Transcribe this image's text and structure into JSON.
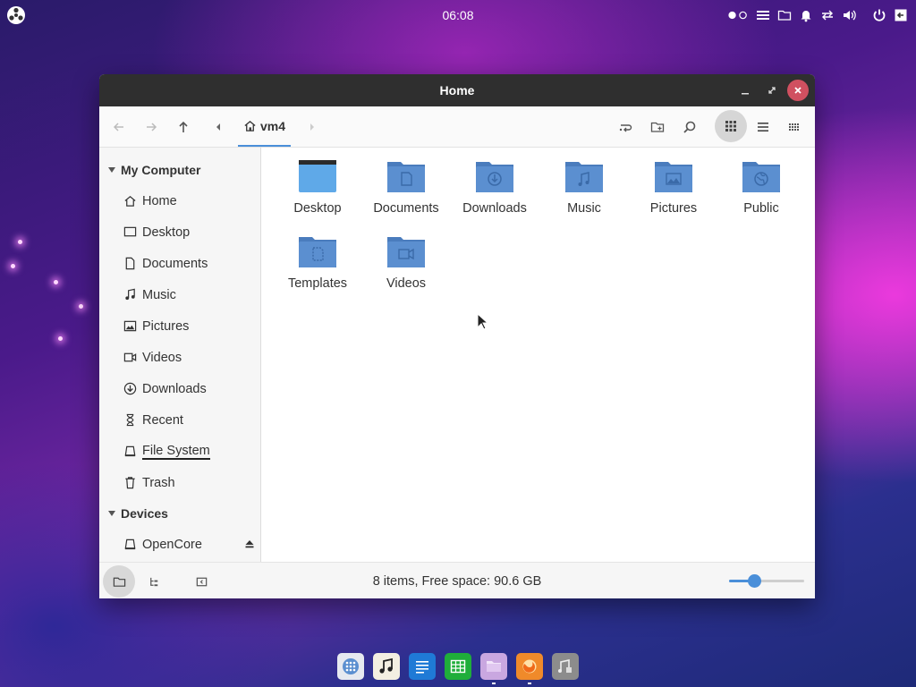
{
  "topbar": {
    "clock": "06:08",
    "tray_icons": [
      "toggle-icon",
      "menu-icon",
      "folder-icon",
      "bell-icon",
      "network-icon",
      "volume-icon",
      "power-icon",
      "logout-icon"
    ]
  },
  "window": {
    "title": "Home",
    "toolbar": {
      "breadcrumb": "vm4"
    },
    "sidebar": {
      "sections": [
        {
          "title": "My Computer",
          "items": [
            {
              "label": "Home",
              "icon": "home-icon"
            },
            {
              "label": "Desktop",
              "icon": "desktop-icon"
            },
            {
              "label": "Documents",
              "icon": "document-icon"
            },
            {
              "label": "Music",
              "icon": "music-icon"
            },
            {
              "label": "Pictures",
              "icon": "picture-icon"
            },
            {
              "label": "Videos",
              "icon": "video-icon"
            },
            {
              "label": "Downloads",
              "icon": "download-icon"
            },
            {
              "label": "Recent",
              "icon": "recent-icon"
            },
            {
              "label": "File System",
              "icon": "drive-icon"
            },
            {
              "label": "Trash",
              "icon": "trash-icon"
            }
          ]
        },
        {
          "title": "Devices",
          "items": [
            {
              "label": "OpenCore",
              "icon": "drive-icon"
            }
          ]
        }
      ]
    },
    "files": [
      {
        "label": "Desktop",
        "icon": "desktop-folder-icon"
      },
      {
        "label": "Documents",
        "icon": "documents-folder-icon"
      },
      {
        "label": "Downloads",
        "icon": "downloads-folder-icon"
      },
      {
        "label": "Music",
        "icon": "music-folder-icon"
      },
      {
        "label": "Pictures",
        "icon": "pictures-folder-icon"
      },
      {
        "label": "Public",
        "icon": "public-folder-icon"
      },
      {
        "label": "Templates",
        "icon": "templates-folder-icon"
      },
      {
        "label": "Videos",
        "icon": "videos-folder-icon"
      }
    ],
    "status": "8 items, Free space: 90.6 GB",
    "zoom_level": 0.33
  },
  "dock": {
    "apps": [
      "apps-icon",
      "music-app-icon",
      "writer-icon",
      "calc-icon",
      "files-icon",
      "firefox-icon",
      "settings-icon"
    ]
  },
  "colors": {
    "accent": "#4a8fd9",
    "folder": "#5b8fd0",
    "close": "#d05060"
  }
}
